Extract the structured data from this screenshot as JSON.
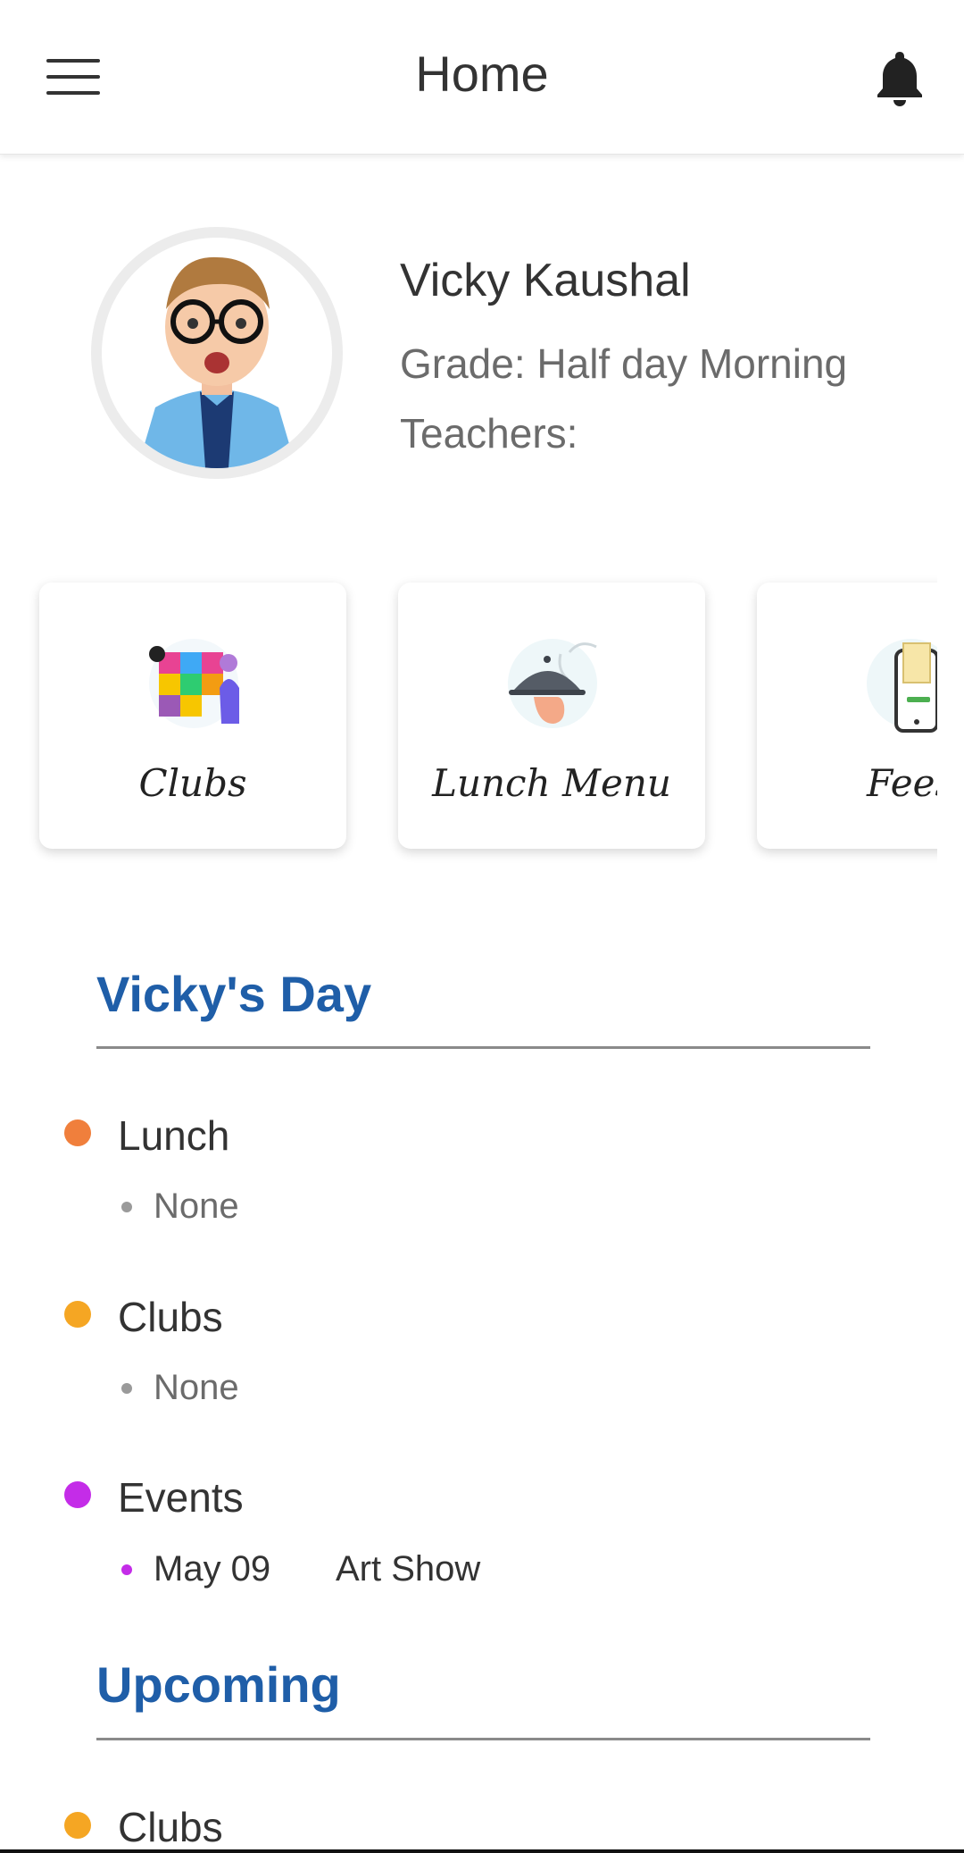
{
  "header": {
    "title": "Home"
  },
  "profile": {
    "name": "Vicky Kaushal",
    "grade": "Grade: Half day Morning",
    "teachers": "Teachers:"
  },
  "cards": [
    {
      "label": "Clubs",
      "icon": "clubs-puzzle-icon"
    },
    {
      "label": "Lunch Menu",
      "icon": "lunch-cloche-icon"
    },
    {
      "label": "Fees",
      "icon": "fees-phone-icon"
    }
  ],
  "day": {
    "title": "Vicky's Day",
    "items": [
      {
        "title": "Lunch",
        "color": "#f07f3c",
        "sub": "None"
      },
      {
        "title": "Clubs",
        "color": "#f5a623",
        "sub": "None"
      },
      {
        "title": "Events",
        "color": "#c42ce8",
        "date": "May 09",
        "event": "Art Show"
      }
    ]
  },
  "upcoming": {
    "title": "Upcoming",
    "items": [
      {
        "title": "Clubs",
        "color": "#f5a623"
      }
    ]
  }
}
